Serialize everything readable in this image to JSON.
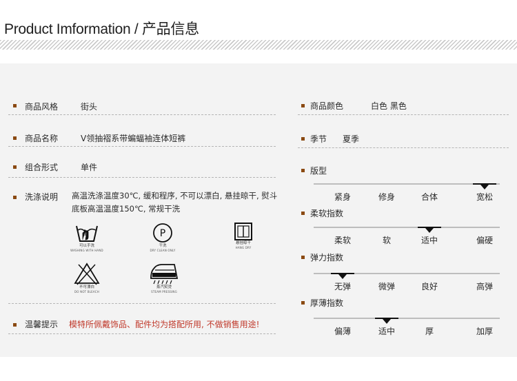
{
  "header": {
    "title": "Product Imformation / 产品信息"
  },
  "left": {
    "rows": [
      {
        "label": "商品风格",
        "value": "街头"
      },
      {
        "label": "商品名称",
        "value": "V领抽褶系带蝙蝠袖连体短裤"
      },
      {
        "label": "组合形式",
        "value": "单件"
      }
    ],
    "wash": {
      "label": "洗涤说明",
      "text": "高温洗涤温度30℃, 缓和程序, 不可以漂白, 悬挂晾干, 熨斗底板高温温度150℃, 常规干洗"
    },
    "care_icons": [
      {
        "name": "hand-wash",
        "cn": "可以手洗",
        "en": "WASHING WITH HAND"
      },
      {
        "name": "dry-clean",
        "cn": "干洗",
        "en": "DRY CLEAN ONLY",
        "symbol": "P"
      },
      {
        "name": "hang-dry",
        "cn": "悬挂晾干",
        "en": "HANG DRY"
      },
      {
        "name": "no-bleach",
        "cn": "不可漂白",
        "en": "DO NOT BLEACH"
      },
      {
        "name": "steam-iron",
        "cn": "蒸汽熨烫",
        "en": "STEAM PRESSING"
      }
    ],
    "tip": {
      "label": "温馨提示",
      "text": "模特所佩戴饰品、配件均为搭配所用, 不做销售用途!"
    }
  },
  "right": {
    "color": {
      "label": "商品颜色",
      "value": "白色 黑色"
    },
    "season": {
      "label": "季节",
      "value": "夏季"
    },
    "scales": [
      {
        "title": "版型",
        "options": [
          "紧身",
          "修身",
          "合体",
          "宽松"
        ],
        "selected": 3
      },
      {
        "title": "柔软指数",
        "options": [
          "柔软",
          "软",
          "适中",
          "偏硬"
        ],
        "selected": 2
      },
      {
        "title": "弹力指数",
        "options": [
          "无弹",
          "微弹",
          "良好",
          "高弹"
        ],
        "selected": 0
      },
      {
        "title": "厚薄指数",
        "options": [
          "偏薄",
          "适中",
          "厚",
          "加厚"
        ],
        "selected": 1
      }
    ]
  },
  "colors": {
    "bullet": "#8a4a12",
    "tip": "#c0392b",
    "panel": "#f3f3f3"
  }
}
